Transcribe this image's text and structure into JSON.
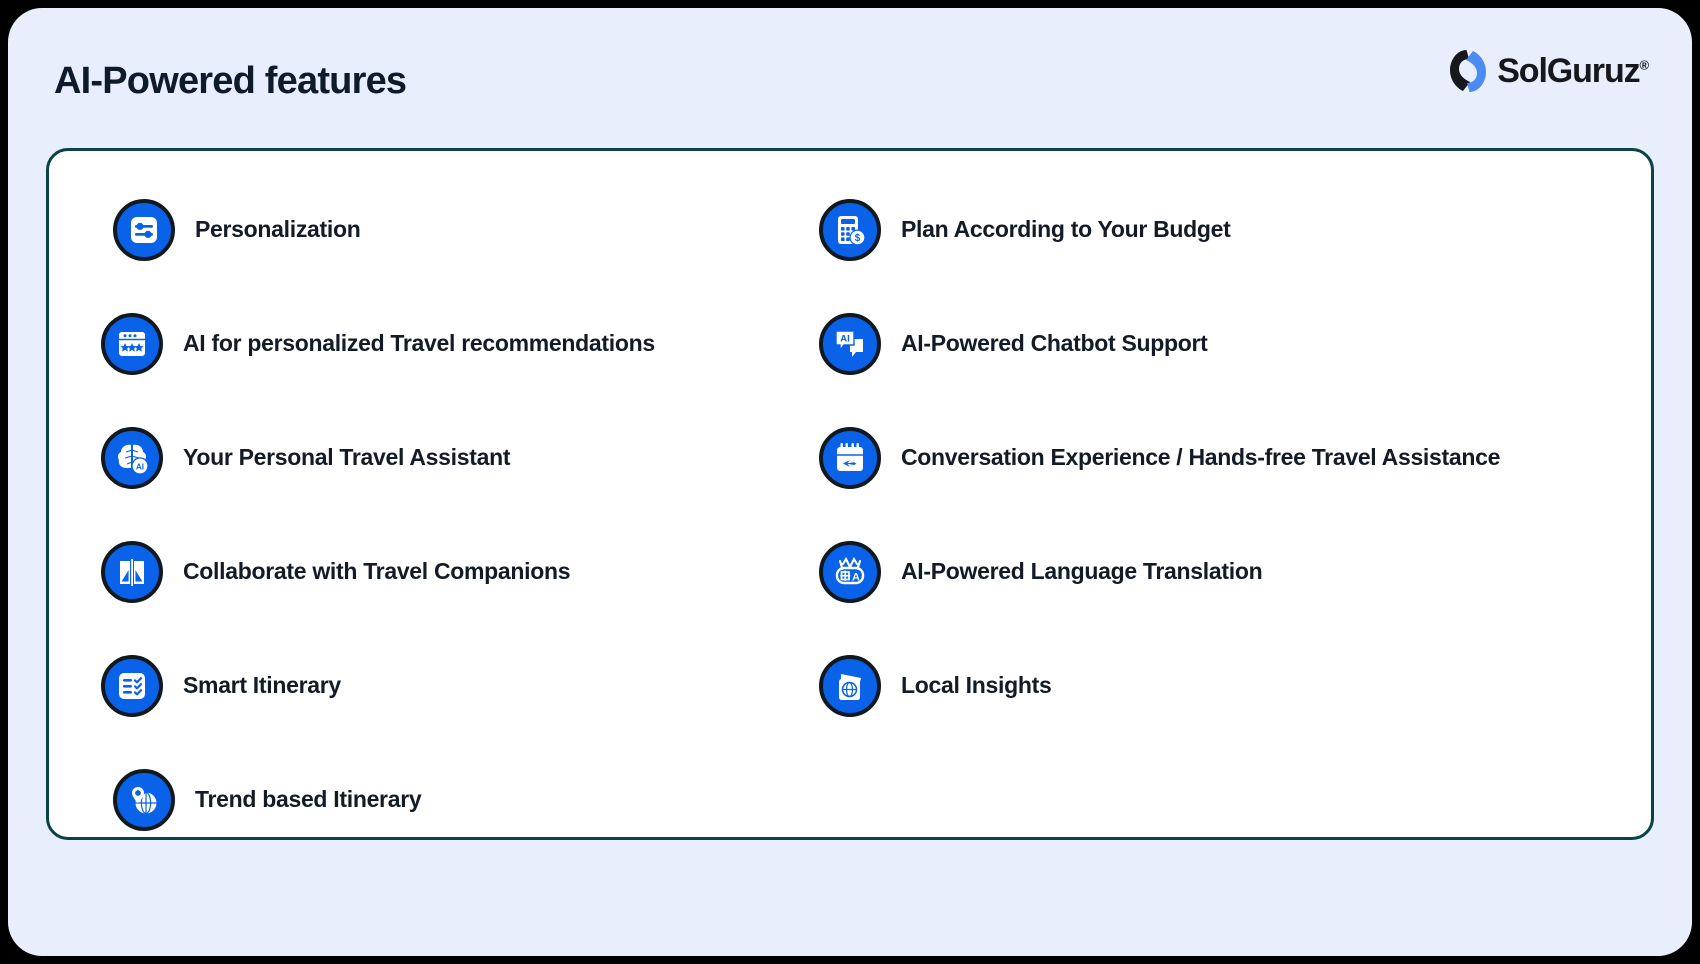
{
  "header": {
    "title": "AI-Powered features",
    "logo": {
      "mark_name": "solguruz-logo-mark",
      "text": "SolGuruz",
      "registered": "®",
      "brand_blue": "#4b8bf5",
      "brand_dark": "#16181d"
    }
  },
  "theme": {
    "page_background": "#000000",
    "outer_card_background": "#e8eefc",
    "inner_card_background": "#ffffff",
    "inner_card_border": "#0b4246",
    "icon_circle_fill": "#0a62e8",
    "icon_circle_stroke": "#101820",
    "text_color": "#131c26",
    "title_color": "#0d1b2a"
  },
  "features": {
    "left_column": [
      {
        "label": "Personalization",
        "icon": "sliders-settings-icon",
        "indent": true
      },
      {
        "label": "AI for personalized Travel recommendations",
        "icon": "browser-stars-icon",
        "indent": false
      },
      {
        "label": "Your Personal Travel Assistant",
        "icon": "brain-ai-icon",
        "indent": false
      },
      {
        "label": "Collaborate with Travel Companions",
        "icon": "collaborate-book-icon",
        "indent": false
      },
      {
        "label": "Smart Itinerary",
        "icon": "checklist-icon",
        "indent": false
      },
      {
        "label": "Trend based Itinerary",
        "icon": "globe-pin-icon",
        "indent": true
      }
    ],
    "right_column": [
      {
        "label": "Plan According to Your Budget",
        "icon": "calculator-dollar-icon",
        "indent": false
      },
      {
        "label": "AI-Powered Chatbot Support",
        "icon": "chat-ai-icon",
        "indent": false
      },
      {
        "label": "Conversation Experience / Hands-free Travel Assistance",
        "icon": "calendar-plane-icon",
        "indent": false
      },
      {
        "label": "AI-Powered Language Translation",
        "icon": "robot-translate-icon",
        "indent": false
      },
      {
        "label": "Local Insights",
        "icon": "passport-globe-icon",
        "indent": false
      }
    ]
  }
}
